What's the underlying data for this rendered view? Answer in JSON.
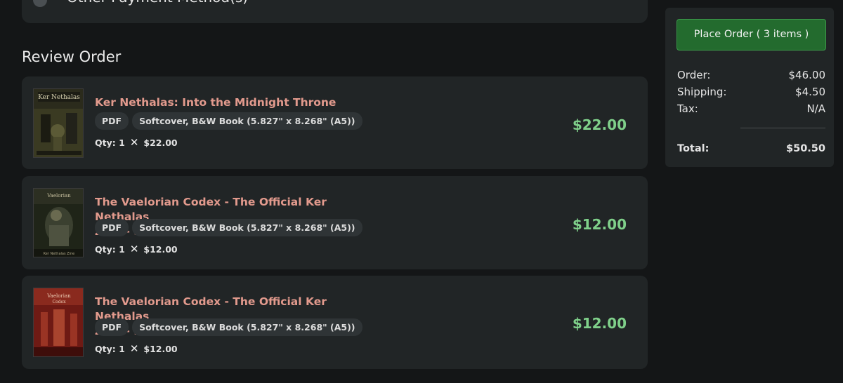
{
  "payment": {
    "other_method_label": "Other Payment Method(s)"
  },
  "review": {
    "heading": "Review Order",
    "items": [
      {
        "title_line1": "Ker Nethalas: Into the Midnight Throne",
        "title_line2": "",
        "tags": [
          "PDF",
          "Softcover, B&W Book (5.827\" x 8.268\" (A5))"
        ],
        "qty_label": "Qty: 1",
        "unit_price": "$22.00",
        "line_price": "$22.00"
      },
      {
        "title_line1": "The Vaelorian Codex - The Official Ker Nethalas",
        "title_line2": "Zine - Second Issue",
        "tags": [
          "PDF",
          "Softcover, B&W Book (5.827\" x 8.268\" (A5))"
        ],
        "qty_label": "Qty: 1",
        "unit_price": "$12.00",
        "line_price": "$12.00"
      },
      {
        "title_line1": "The Vaelorian Codex - The Official Ker Nethalas",
        "title_line2": "Zine - First Issue",
        "tags": [
          "PDF",
          "Softcover, B&W Book (5.827\" x 8.268\" (A5))"
        ],
        "qty_label": "Qty: 1",
        "unit_price": "$12.00",
        "line_price": "$12.00"
      }
    ]
  },
  "summary": {
    "place_order_label": "Place Order ( 3 items )",
    "order_label": "Order:",
    "order_value": "$46.00",
    "shipping_label": "Shipping:",
    "shipping_value": "$4.50",
    "tax_label": "Tax:",
    "tax_value": "N/A",
    "total_label": "Total:",
    "total_value": "$50.50"
  },
  "icons": {
    "remove": "close-icon"
  },
  "colors": {
    "background": "#141617",
    "card": "#212526",
    "title": "#e29a8d",
    "price": "#7fd08a",
    "button": "#236b2e"
  }
}
